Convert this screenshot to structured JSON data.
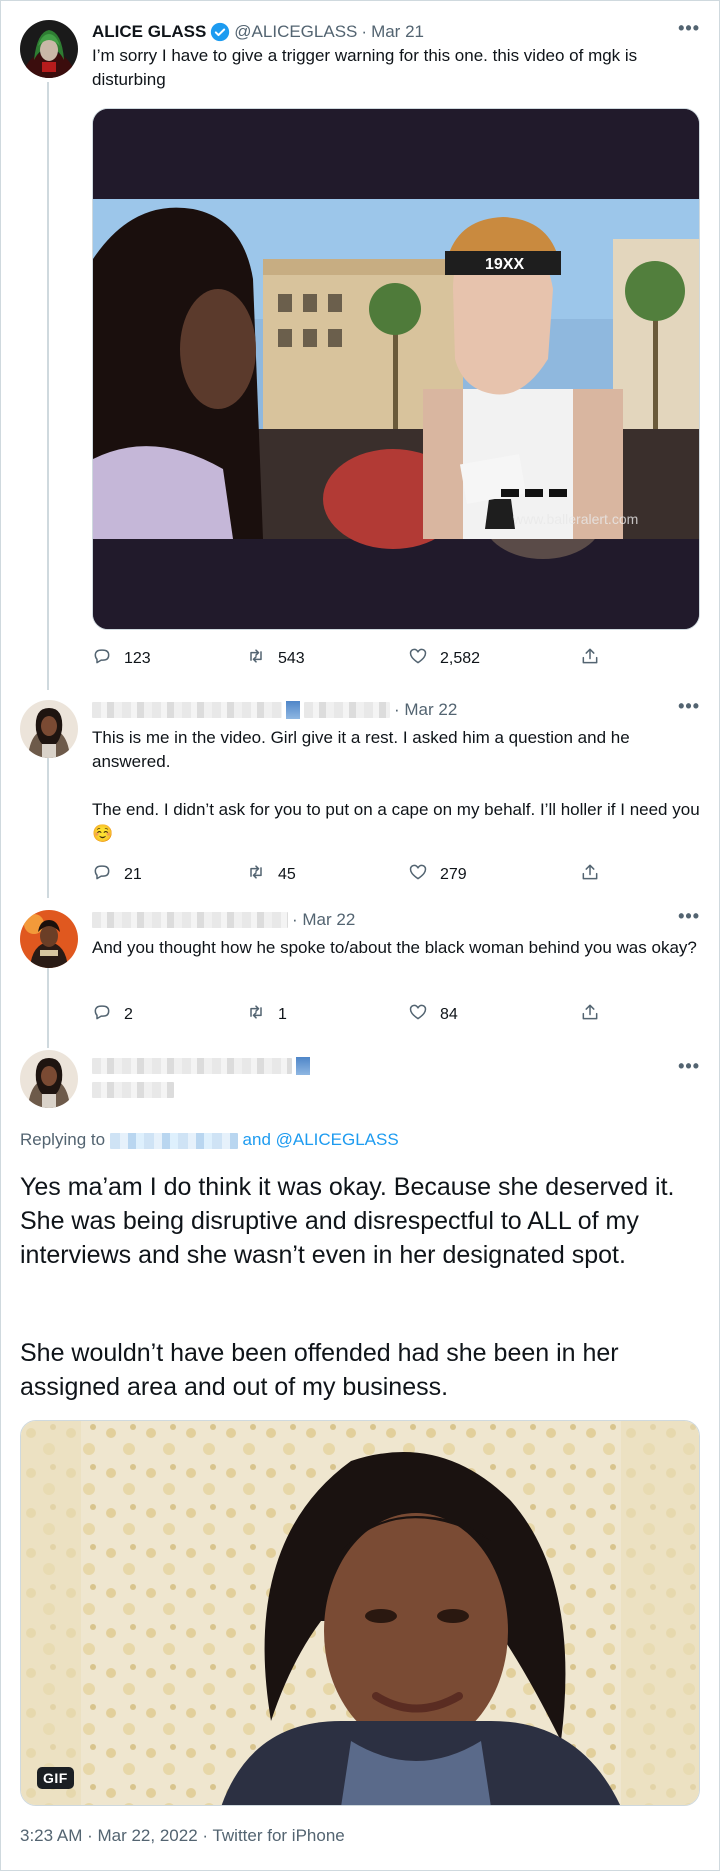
{
  "tweet1": {
    "name": "ALICE GLASS",
    "handle": "@ALICEGLASS",
    "sep": "·",
    "date": "Mar 21",
    "text": "I’m sorry I have to give a trigger warning for this one. this video of mgk is disturbing",
    "video_watermark": "www.balleralert.com",
    "shirt_text": "19XX",
    "stats": {
      "replies": "123",
      "retweets": "543",
      "likes": "2,582"
    }
  },
  "tweet2": {
    "date": "· Mar 22",
    "text1": "This is me in the video. Girl give it a rest. I asked him a question and he answered.",
    "text2": "The end. I didn’t ask for you to put on a cape on my behalf. I’ll holler if I need you ☺️",
    "stats": {
      "replies": "21",
      "retweets": "45",
      "likes": "279"
    }
  },
  "tweet3": {
    "date": "· Mar 22",
    "text": "And you thought how he spoke to/about the black woman behind you was okay?",
    "stats": {
      "replies": "2",
      "retweets": "1",
      "likes": "84"
    }
  },
  "main_tweet": {
    "replying_prefix": "Replying to",
    "replying_suffix": "and @ALICEGLASS",
    "paragraph1": "Yes ma’am I do think it was okay. Because she deserved it. She was being disruptive and disrespectful to ALL of my interviews and she wasn’t even in her designated spot.",
    "paragraph2": "She wouldn’t have been offended had she been in her assigned area and out of my business.",
    "gif_badge": "GIF",
    "footer": "3:23 AM · Mar 22, 2022 · Twitter for iPhone"
  },
  "icons": {
    "more": "more-icon",
    "reply": "reply-icon",
    "retweet": "retweet-icon",
    "like": "like-icon",
    "share": "share-icon",
    "verified": "verified-icon"
  },
  "colors": {
    "text": "#0f1419",
    "secondary": "#536471",
    "link": "#1d9bf0",
    "border": "#cfd9de"
  }
}
